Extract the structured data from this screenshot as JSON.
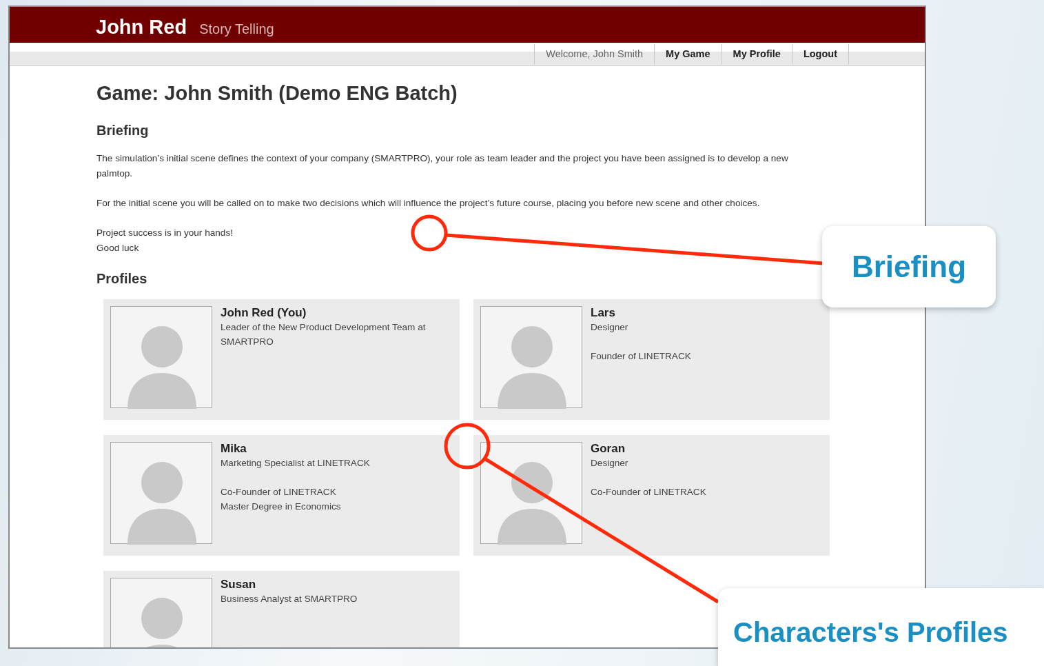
{
  "header": {
    "title": "John Red",
    "subtitle": "Story Telling"
  },
  "nav": [
    {
      "kind": "text",
      "label": "Welcome, John Smith"
    },
    {
      "kind": "link",
      "label": "My Game"
    },
    {
      "kind": "link",
      "label": "My Profile"
    },
    {
      "kind": "link",
      "label": "Logout"
    }
  ],
  "page_title": "Game: John Smith (Demo ENG Batch)",
  "briefing": {
    "heading": "Briefing",
    "paragraphs": [
      [
        "The simulation’s initial scene defines the context of your company (SMARTPRO), your role as team leader and the project you have been assigned is to develop a new palmtop."
      ],
      [
        "For the initial scene you will be called on to make two decisions which will influence the project’s future course, placing you before new scene and other choices."
      ],
      [
        "Project success is in your hands!",
        "Good luck"
      ]
    ]
  },
  "profiles": {
    "heading": "Profiles",
    "items": [
      {
        "name": "John Red (You)",
        "blocks": [
          [
            "Leader of the New Product Development Team at SMARTPRO"
          ]
        ]
      },
      {
        "name": "Lars",
        "blocks": [
          [
            "Designer"
          ],
          [
            "Founder of LINETRACK"
          ]
        ]
      },
      {
        "name": "Mika",
        "blocks": [
          [
            "Marketing Specialist at LINETRACK"
          ],
          [
            "Co-Founder of LINETRACK",
            "Master Degree in Economics"
          ]
        ]
      },
      {
        "name": "Goran",
        "blocks": [
          [
            "Designer"
          ],
          [
            "Co-Founder of LINETRACK"
          ]
        ]
      },
      {
        "name": "Susan",
        "blocks": [
          [
            "Business Analyst at SMARTPRO"
          ]
        ]
      }
    ]
  },
  "callouts": [
    {
      "label": "Briefing"
    },
    {
      "label": "Characters's Profiles"
    }
  ]
}
